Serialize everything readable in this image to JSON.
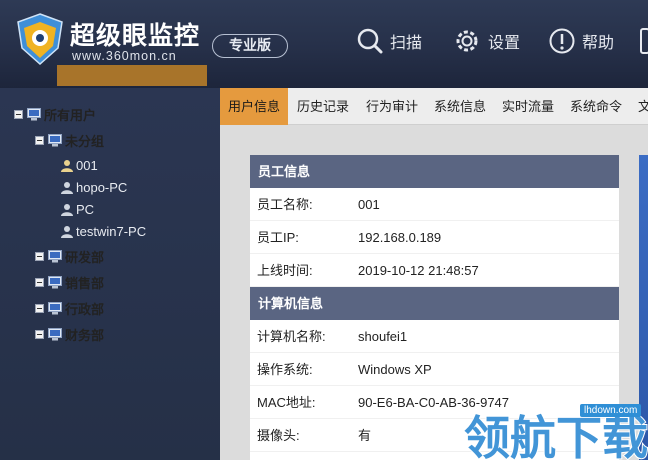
{
  "header": {
    "brand": "超级眼监控",
    "domain": "www.360mon.cn",
    "edition": "专业版",
    "buttons": {
      "scan": "扫描",
      "settings": "设置",
      "help": "帮助"
    }
  },
  "tree": {
    "root": "所有用户",
    "groups": [
      {
        "label": "未分组",
        "users": [
          "001",
          "hopo-PC",
          "PC",
          "testwin7-PC"
        ],
        "selected": "001"
      },
      {
        "label": "研发部"
      },
      {
        "label": "销售部"
      },
      {
        "label": "行政部"
      },
      {
        "label": "财务部"
      }
    ]
  },
  "tabs": [
    "用户信息",
    "历史记录",
    "行为审计",
    "系统信息",
    "实时流量",
    "系统命令",
    "文"
  ],
  "active_tab": "用户信息",
  "employee": {
    "title": "员工信息",
    "rows": [
      {
        "k": "员工名称:",
        "v": "001"
      },
      {
        "k": "员工IP:",
        "v": "192.168.0.189"
      },
      {
        "k": "上线时间:",
        "v": "2019-10-12 21:48:57"
      }
    ]
  },
  "computer": {
    "title": "计算机信息",
    "rows": [
      {
        "k": "计算机名称:",
        "v": "shoufei1"
      },
      {
        "k": "操作系统:",
        "v": "Windows XP"
      },
      {
        "k": "MAC地址:",
        "v": "90-E6-BA-C0-AB-36-9747"
      },
      {
        "k": "摄像头:",
        "v": "有"
      }
    ]
  },
  "watermark": {
    "text": "领航下载",
    "url": "lhdown.com"
  },
  "colors": {
    "header_bg": "#263049",
    "accent": "#e59a3e",
    "section_bg": "#5a6582",
    "selected": "#a8742a"
  }
}
